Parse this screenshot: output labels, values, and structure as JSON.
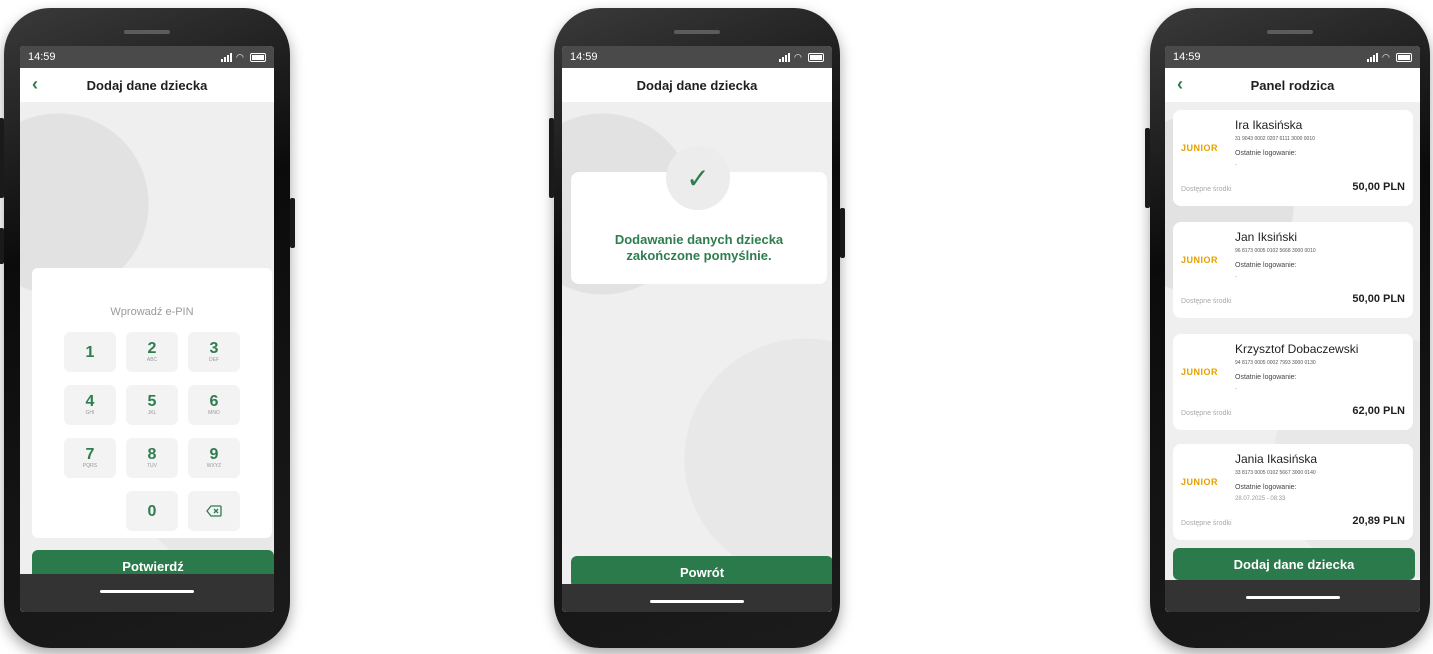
{
  "status": {
    "time": "14:59"
  },
  "phone1": {
    "title": "Dodaj dane dziecka",
    "pin_prompt": "Wprowadź e-PIN",
    "keys": [
      {
        "digit": "1",
        "letters": ""
      },
      {
        "digit": "2",
        "letters": "ABC"
      },
      {
        "digit": "3",
        "letters": "DEF"
      },
      {
        "digit": "4",
        "letters": "GHI"
      },
      {
        "digit": "5",
        "letters": "JKL"
      },
      {
        "digit": "6",
        "letters": "MNO"
      },
      {
        "digit": "7",
        "letters": "PQRS"
      },
      {
        "digit": "8",
        "letters": "TUV"
      },
      {
        "digit": "9",
        "letters": "WXYZ"
      },
      {
        "digit": "0",
        "letters": ""
      }
    ],
    "confirm_label": "Potwierdź"
  },
  "phone2": {
    "title": "Dodaj dane dziecka",
    "message_line1": "Dodawanie danych dziecka",
    "message_line2": "zakończone pomyślnie.",
    "back_label": "Powrót"
  },
  "phone3": {
    "title": "Panel rodzica",
    "children": [
      {
        "name": "Ira Ikasińska",
        "account": "31 9043 0002 0207 6111 3000 0010",
        "last_login_label": "Ostatnie logowanie:",
        "last_login_value": "-",
        "funds_label": "Dostępne środki",
        "funds_value": "50,00 PLN"
      },
      {
        "name": "Jan Iksiński",
        "account": "96 8173 0005 0102 5668 3000 0010",
        "last_login_label": "Ostatnie logowanie:",
        "last_login_value": "-",
        "funds_label": "Dostępne środki",
        "funds_value": "50,00 PLN"
      },
      {
        "name": "Krzysztof Dobaczewski",
        "account": "94 8173 0005 0002 7993 3000 0130",
        "last_login_label": "Ostatnie logowanie:",
        "last_login_value": "-",
        "funds_label": "Dostępne środki",
        "funds_value": "62,00 PLN"
      },
      {
        "name": "Jania Ikasińska",
        "account": "33 8173 0005 0102 5667 3000 0140",
        "last_login_label": "Ostatnie logowanie:",
        "last_login_value": "28.07.2025 - 08:33",
        "funds_label": "Dostępne środki",
        "funds_value": "20,89 PLN"
      }
    ],
    "junior_logo": "JUNIOR",
    "add_label": "Dodaj dane dziecka"
  },
  "colors": {
    "accent": "#2b7a4b"
  }
}
